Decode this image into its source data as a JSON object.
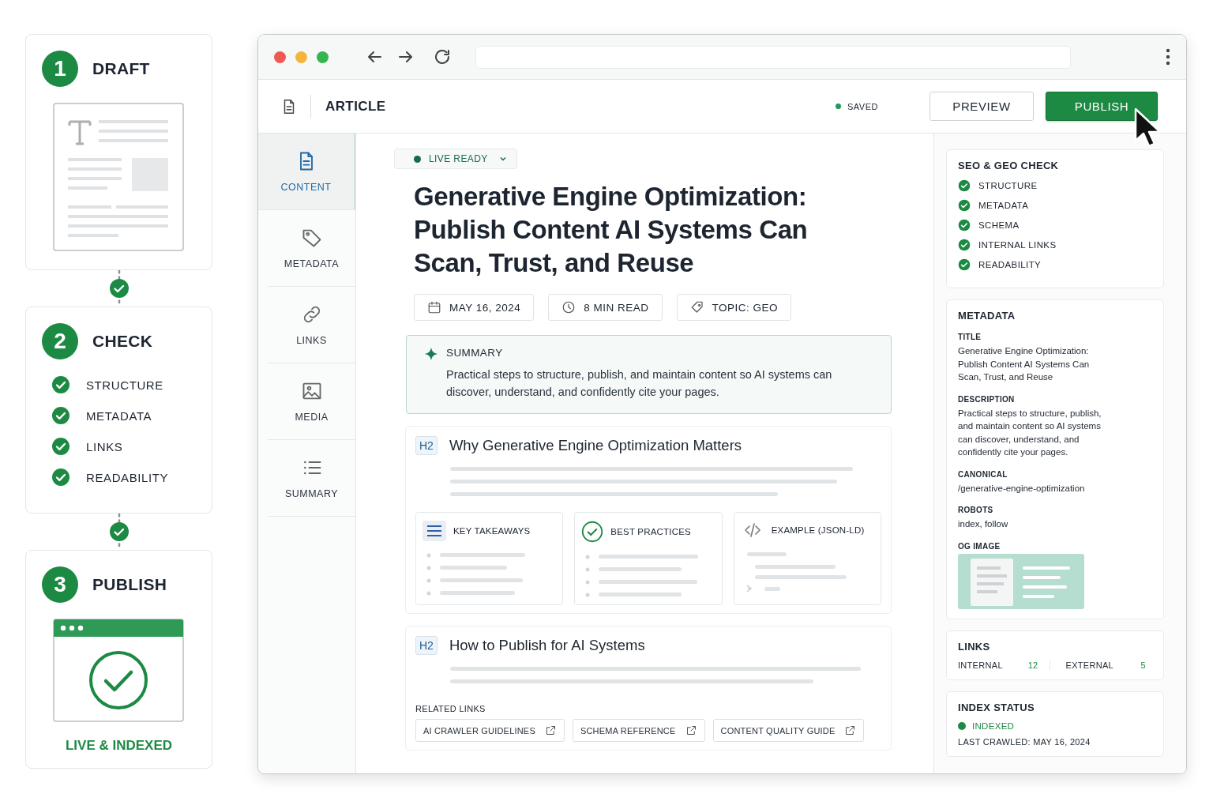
{
  "steps": [
    {
      "number": "1",
      "title": "DRAFT",
      "kind": "draft"
    },
    {
      "number": "2",
      "title": "CHECK",
      "kind": "check",
      "checks": [
        {
          "label": "STRUCTURE",
          "checked": true
        },
        {
          "label": "METADATA",
          "checked": true
        },
        {
          "label": "LINKS",
          "checked": true
        },
        {
          "label": "READABILITY",
          "checked": true
        }
      ]
    },
    {
      "number": "3",
      "title": "PUBLISH",
      "kind": "publish",
      "caption": "LIVE & INDEXED"
    }
  ],
  "header": {
    "title": "ARTICLE",
    "status": "SAVED",
    "buttons": [
      {
        "label": "PREVIEW",
        "kind": "secondary"
      },
      {
        "label": "PUBLISH",
        "kind": "primary"
      }
    ]
  },
  "nav_items": [
    {
      "label": "CONTENT",
      "kind": "doc",
      "selected": true
    },
    {
      "label": "METADATA",
      "kind": "tag",
      "selected": false
    },
    {
      "label": "LINKS",
      "kind": "link",
      "selected": false
    },
    {
      "label": "MEDIA",
      "kind": "image",
      "selected": false
    },
    {
      "label": "SUMMARY",
      "kind": "list",
      "selected": false
    }
  ],
  "article": {
    "status_pill": "LIVE READY",
    "title": "Generative Engine Optimization: Publish Content AI Systems Can Scan, Trust, and Reuse",
    "meta": [
      {
        "label": "MAY 16, 2024",
        "kind": "date"
      },
      {
        "label": "8 MIN READ",
        "kind": "time"
      },
      {
        "label": "TOPIC: GEO",
        "kind": "topic"
      }
    ],
    "summary": {
      "label": "SUMMARY",
      "text": "Practical steps to structure, publish, and maintain content so AI systems can discover, understand, and confidently cite your pages."
    },
    "sections": [
      {
        "tag": "H2",
        "heading": "Why Generative Engine Optimization Matters",
        "cards": [
          {
            "title": "KEY TAKEAWAYS",
            "kind": "list"
          },
          {
            "title": "BEST PRACTICES",
            "kind": "check"
          },
          {
            "title": "EXAMPLE (JSON-LD)",
            "kind": "code"
          }
        ]
      },
      {
        "tag": "H2",
        "heading": "How to Publish for AI Systems",
        "related_label": "RELATED LINKS",
        "links": [
          "AI CRAWLER GUIDELINES",
          "SCHEMA REFERENCE",
          "CONTENT QUALITY GUIDE"
        ]
      }
    ]
  },
  "sidebar": {
    "seo_check": {
      "title": "SEO & GEO CHECK",
      "items": [
        {
          "label": "STRUCTURE",
          "checked": true
        },
        {
          "label": "METADATA",
          "checked": true
        },
        {
          "label": "SCHEMA",
          "checked": true
        },
        {
          "label": "INTERNAL LINKS",
          "checked": true
        },
        {
          "label": "READABILITY",
          "checked": true
        }
      ]
    },
    "metadata": {
      "title": "METADATA",
      "fields": [
        {
          "label": "TITLE",
          "value": "Generative Engine Optimization: Publish Content AI Systems Can Scan, Trust, and Reuse"
        },
        {
          "label": "DESCRIPTION",
          "value": "Practical steps to structure, publish, and maintain content so AI systems can discover, understand, and confidently cite your pages."
        },
        {
          "label": "CANONICAL",
          "value": "/generative-engine-optimization"
        },
        {
          "label": "ROBOTS",
          "value": "index, follow"
        }
      ],
      "og_image_label": "OG IMAGE"
    },
    "links": {
      "title": "LINKS",
      "stats": [
        {
          "label": "INTERNAL",
          "value": "12"
        },
        {
          "label": "EXTERNAL",
          "value": "5"
        }
      ]
    },
    "index_status": {
      "title": "INDEX STATUS",
      "status": "INDEXED",
      "last_crawled": "LAST CRAWLED: MAY 16, 2024"
    }
  }
}
